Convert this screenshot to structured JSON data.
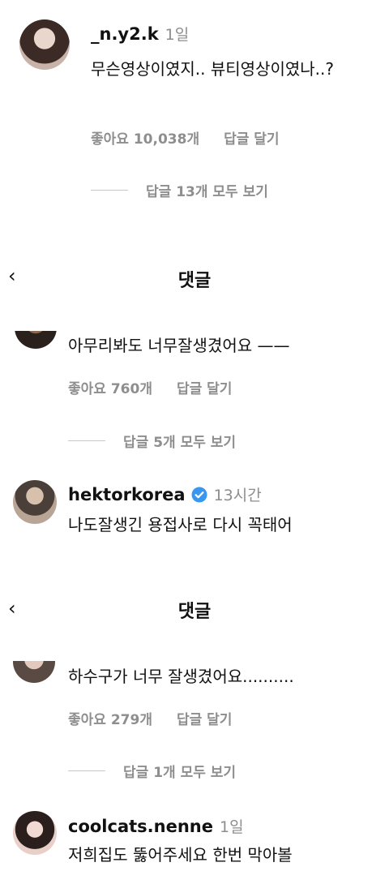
{
  "comment1": {
    "username": "_n.y2.k",
    "time": "1일",
    "text": "무슨영상이였지.. 뷰티영상이였나..?",
    "likes": "좋아요 10,038개",
    "reply_btn": "답글 달기",
    "view_replies": "답글 13개 모두 보기"
  },
  "header1": {
    "title": "댓글",
    "back_icon": "‹"
  },
  "comment2": {
    "text": "아무리봐도 너무잘생겼어요 ——",
    "likes": "좋아요 760개",
    "reply_btn": "답글 달기",
    "view_replies": "답글 5개 모두 보기"
  },
  "comment3": {
    "username": "hektorkorea",
    "verified_icon": "verified-badge",
    "time": "13시간",
    "text": "나도잘생긴 용접사로 다시 꼭태어"
  },
  "header2": {
    "title": "댓글",
    "back_icon": "‹"
  },
  "comment4": {
    "text": "하수구가 너무 잘생겼어요..........",
    "likes": "좋아요 279개",
    "reply_btn": "답글 달기",
    "view_replies": "답글 1개 모두 보기"
  },
  "comment5": {
    "username": "coolcats.nenne",
    "time": "1일",
    "text": "저희집도 뚫어주세요 한번 막아볼"
  },
  "colors": {
    "text": "#111111",
    "secondary": "#8e8e8e",
    "verified": "#3897f0"
  }
}
